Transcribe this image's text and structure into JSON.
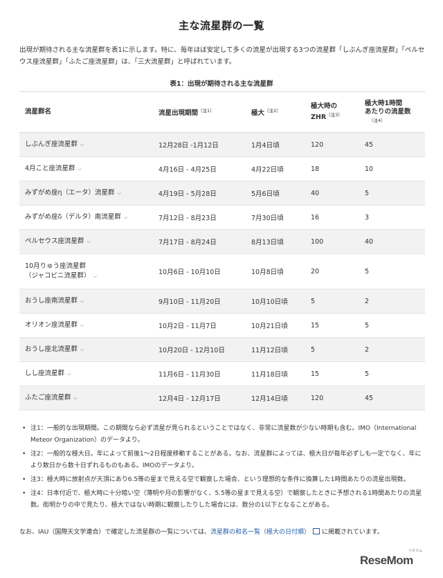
{
  "page": {
    "title": "主な流星群の一覧",
    "intro": "出現が期待される主な流星群を表1に示します。特に、毎年ほぼ安定して多くの流星が出現する3つの流星群「しぶんぎ座流星群」「ペルセウス座流星群」「ふたご座流星群」は、「三大流星群」と呼ばれています。",
    "table_caption": "表1：出現が期待される主な流星群"
  },
  "table": {
    "headers": {
      "name": "流星群名",
      "period": "流星出現期間",
      "period_note": "（注1）",
      "peak": "極大",
      "peak_note": "（注2）",
      "zhr_l1": "極大時の",
      "zhr_l2": "ZHR",
      "zhr_note": "（注3）",
      "rate_l1": "極大時1時間",
      "rate_l2": "あたりの流星数",
      "rate_note": "（注4）"
    },
    "rows": [
      {
        "name": "しぶんぎ座流星群",
        "name2": "",
        "period": "12月28日 -1月12日",
        "peak": "1月4日頃",
        "zhr": "120",
        "rate": "45"
      },
      {
        "name": "4月こと座流星群",
        "name2": "",
        "period": "4月16日 - 4月25日",
        "peak": "4月22日頃",
        "zhr": "18",
        "rate": "10"
      },
      {
        "name": "みずがめ座η（エータ）流星群",
        "name2": "",
        "period": "4月19日 - 5月28日",
        "peak": "5月6日頃",
        "zhr": "40",
        "rate": "5"
      },
      {
        "name": "みずがめ座δ（デルタ）南流星群",
        "name2": "",
        "period": "7月12日 - 8月23日",
        "peak": "7月30日頃",
        "zhr": "16",
        "rate": "3"
      },
      {
        "name": "ペルセウス座流星群",
        "name2": "",
        "period": "7月17日 - 8月24日",
        "peak": "8月13日頃",
        "zhr": "100",
        "rate": "40"
      },
      {
        "name": "10月りゅう座流星群",
        "name2": "（ジャコビニ流星群）",
        "period": "10月6日 - 10月10日",
        "peak": "10月8日頃",
        "zhr": "20",
        "rate": "5"
      },
      {
        "name": "おうし座南流星群",
        "name2": "",
        "period": "9月10日 - 11月20日",
        "peak": "10月10日頃",
        "zhr": "5",
        "rate": "2"
      },
      {
        "name": "オリオン座流星群",
        "name2": "",
        "period": "10月2日 - 11月7日",
        "peak": "10月21日頃",
        "zhr": "15",
        "rate": "5"
      },
      {
        "name": "おうし座北流星群",
        "name2": "",
        "period": "10月20日 - 12月10日",
        "peak": "11月12日頃",
        "zhr": "5",
        "rate": "2"
      },
      {
        "name": "しし座流星群",
        "name2": "",
        "period": "11月6日 - 11月30日",
        "peak": "11月18日頃",
        "zhr": "15",
        "rate": "5"
      },
      {
        "name": "ふたご座流星群",
        "name2": "",
        "period": "12月4日 - 12月17日",
        "peak": "12月14日頃",
        "zhr": "120",
        "rate": "45"
      }
    ]
  },
  "notes": [
    "注1：一般的な出現期間。この期間なら必ず流星が見られるということではなく、非常に流星数が少ない時期も含む。IMO（International Meteor Organization）のデータより。",
    "注2：一般的な極大日。年によって前後1～2日程度移動することがある。なお、流星群によっては、極大日が毎年必ずしも一定でなく、年により数日から数十日ずれるものもある。IMOのデータより。",
    "注3：極大時に放射点が天頂にあり6.5等の星まで見える空で観察した場合、という理想的な条件に換算した1時間あたりの流星出現数。",
    "注4：日本付近で、極大時に十分暗い空（薄明や月の影響がなく、5.5等の星まで見える空）で観察したときに予想される1時間あたりの流星数。街明かりの中で見たり、極大ではない時期に観察したりした場合には、数分の1以下となることがある。"
  ],
  "footer": {
    "before": "なお、IAU（国際天文学連合）で確定した流星群の一覧については、",
    "link": "流星群の和名一覧（極大の日付順）",
    "after": "に掲載されています。"
  },
  "logo": {
    "text": "ReseMom",
    "ruby": "リセマム"
  },
  "icons": {
    "row_expand": "chevron-down-icon",
    "external_link": "external-link-icon"
  },
  "colors": {
    "link": "#1f5aa6",
    "row_alt": "#f2f2f2"
  }
}
